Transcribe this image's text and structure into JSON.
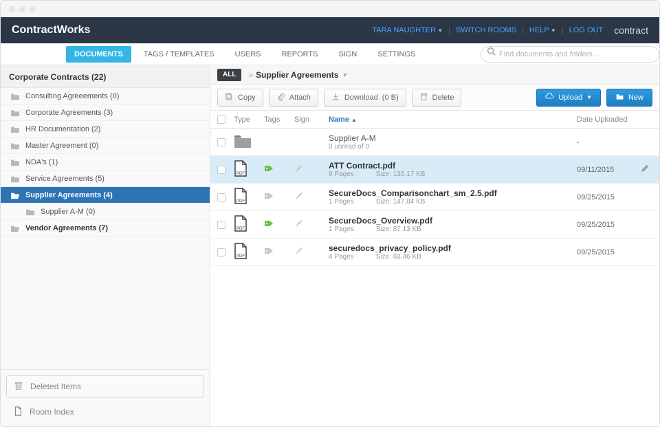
{
  "brand": "ContractWorks",
  "brand2": "contract",
  "topLinks": {
    "user": "TARA NAUGHTER",
    "switch": "SWITCH ROOMS",
    "help": "HELP",
    "logout": "LOG OUT"
  },
  "nav": {
    "tabs": [
      "DOCUMENTS",
      "TAGS / TEMPLATES",
      "USERS",
      "REPORTS",
      "SIGN",
      "SETTINGS"
    ],
    "active": 0,
    "searchPlaceholder": "Find documents and folders ..."
  },
  "sidebar": {
    "title": "Corporate Contracts (22)",
    "items": [
      {
        "label": "Consulting Agreeements (0)"
      },
      {
        "label": "Corporate Agreements (3)"
      },
      {
        "label": "HR Documentation (2)"
      },
      {
        "label": "Master Agreement (0)"
      },
      {
        "label": "NDA's (1)"
      },
      {
        "label": "Service Agreements (5)"
      },
      {
        "label": "Supplier Agreements (4)",
        "selected": true
      },
      {
        "label": "Supplier A-M (0)",
        "child": true
      },
      {
        "label": "Vendor Agreements (7)",
        "bold": true
      }
    ],
    "deleted": "Deleted Items",
    "roomIndex": "Room Index"
  },
  "breadcrumb": {
    "all": "ALL",
    "sep": "»",
    "current": "Supplier Agreements"
  },
  "toolbar": {
    "copy": "Copy",
    "attach": "Attach",
    "downloadPrefix": "Download",
    "downloadSize": "(0 B)",
    "delete": "Delete",
    "upload": "Upload",
    "new": "New"
  },
  "table": {
    "headers": {
      "type": "Type",
      "tags": "Tags",
      "sign": "Sign",
      "name": "Name",
      "date": "Date Uploaded"
    },
    "rows": [
      {
        "kind": "folder",
        "name": "Supplier A-M",
        "sub": "0 unread of 0",
        "date": "-"
      },
      {
        "kind": "pdf",
        "name": "ATT Contract.pdf",
        "pages": "9 Pages",
        "size": "Size: 135.17 KB",
        "date": "09/11/2015",
        "tag": "green",
        "selected": true
      },
      {
        "kind": "pdf",
        "name": "SecureDocs_Comparisonchart_sm_2.5.pdf",
        "pages": "1 Pages",
        "size": "Size: 147.84 KB",
        "date": "09/25/2015",
        "tag": "grey"
      },
      {
        "kind": "pdf",
        "name": "SecureDocs_Overview.pdf",
        "pages": "1 Pages",
        "size": "Size: 87.13 KB",
        "date": "09/25/2015",
        "tag": "green"
      },
      {
        "kind": "pdf",
        "name": "securedocs_privacy_policy.pdf",
        "pages": "4 Pages",
        "size": "Size: 83.46 KB",
        "date": "09/25/2015",
        "tag": "grey"
      }
    ]
  }
}
